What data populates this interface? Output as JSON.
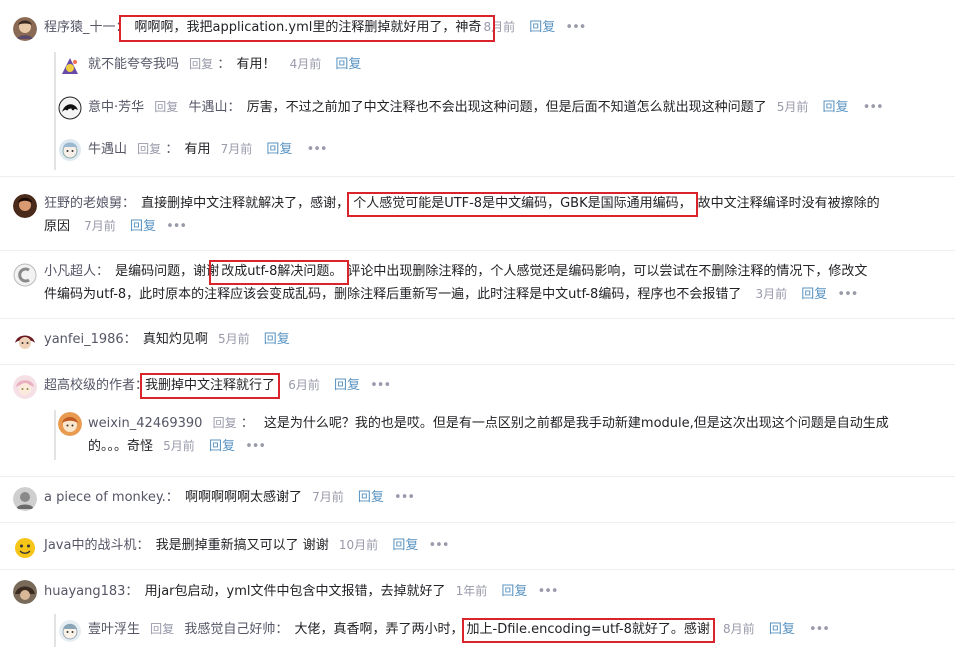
{
  "colors": {
    "name": "#555666",
    "text": "#222226",
    "meta": "#999aaa",
    "link": "#5893c2",
    "highlight": "#d9242b"
  },
  "comments": [
    {
      "author": "程序猿_十一",
      "text": "啊啊啊，我把application.yml里的注释删掉就好用了，神奇",
      "time": "8月前",
      "reply": "回复",
      "more": "•••",
      "replies": [
        {
          "author": "就不能夸夸我吗",
          "tag": "回复",
          "sep": "：",
          "text": "有用！",
          "time": "4月前",
          "reply": "回复",
          "more": "•••"
        },
        {
          "author": "意中·芳华",
          "tag": "回复",
          "target": "牛遇山",
          "sep": "：",
          "text": "厉害，不过之前加了中文注释也不会出现这种问题，但是后面不知道怎么就出现这种问题了",
          "time": "5月前",
          "reply": "回复",
          "more": "•••"
        },
        {
          "author": "牛遇山",
          "tag": "回复",
          "sep": "：",
          "text": "有用",
          "time": "7月前",
          "reply": "回复",
          "more": "•••"
        }
      ]
    },
    {
      "author": "狂野的老娘舅",
      "text_a": "直接删掉中文注释就解决了，感谢，",
      "text_hl": "个人感觉可能是UTF-8是中文编码，GBK是国际通用编码，",
      "text_b": "故中文注释编译时没有被擦除的",
      "text_c": "原因",
      "time": "7月前",
      "reply": "回复",
      "more": "•••"
    },
    {
      "author": "小凡超人",
      "text_a": "是编码问题，谢谢",
      "text_hl": "改成utf-8解决问题。",
      "text_b": "评论中出现删除注释的，个人感觉还是编码影响，可以尝试在不删除注释的情况下，修改文",
      "text_c": "件编码为utf-8，此时原本的注释应该会变成乱码，删除注释后重新写一遍，此时注释是中文utf-8编码，程序也不会报错了",
      "time": "3月前",
      "reply": "回复",
      "more": "•••"
    },
    {
      "author": "yanfei_1986",
      "text": "真知灼见啊",
      "time": "5月前",
      "reply": "回复"
    },
    {
      "author": "超高校级的作者",
      "text": "我删掉中文注释就行了",
      "time": "6月前",
      "reply": "回复",
      "more": "•••",
      "replies": [
        {
          "author": "weixin_42469390",
          "tag": "回复",
          "sep": "：",
          "text_a": "这是为什么呢？我的也是哎。但是有一点区别之前都是我手动新建module,但是这次出现这个问题是自动生成",
          "text_b": "的。。。奇怪",
          "time": "5月前",
          "reply": "回复",
          "more": "•••"
        }
      ]
    },
    {
      "author": "a piece of monkey.",
      "text": "啊啊啊啊啊太感谢了",
      "time": "7月前",
      "reply": "回复",
      "more": "•••"
    },
    {
      "author": "Java中的战斗机",
      "text": "我是删掉重新搞又可以了 谢谢",
      "time": "10月前",
      "reply": "回复",
      "more": "•••"
    },
    {
      "author": "huayang183",
      "text": "用jar包启动，yml文件中包含中文报错，去掉就好了",
      "time": "1年前",
      "reply": "回复",
      "more": "•••",
      "replies": [
        {
          "author": "壹叶浮生",
          "tag": "回复",
          "target": "我感觉自己好帅",
          "sep": "：",
          "text_a": "大佬，真香啊，弄了两小时，",
          "text_hl": "加上-Dfile.encoding=utf-8就好了。感谢",
          "time": "8月前",
          "reply": "回复",
          "more": "•••"
        }
      ]
    }
  ]
}
